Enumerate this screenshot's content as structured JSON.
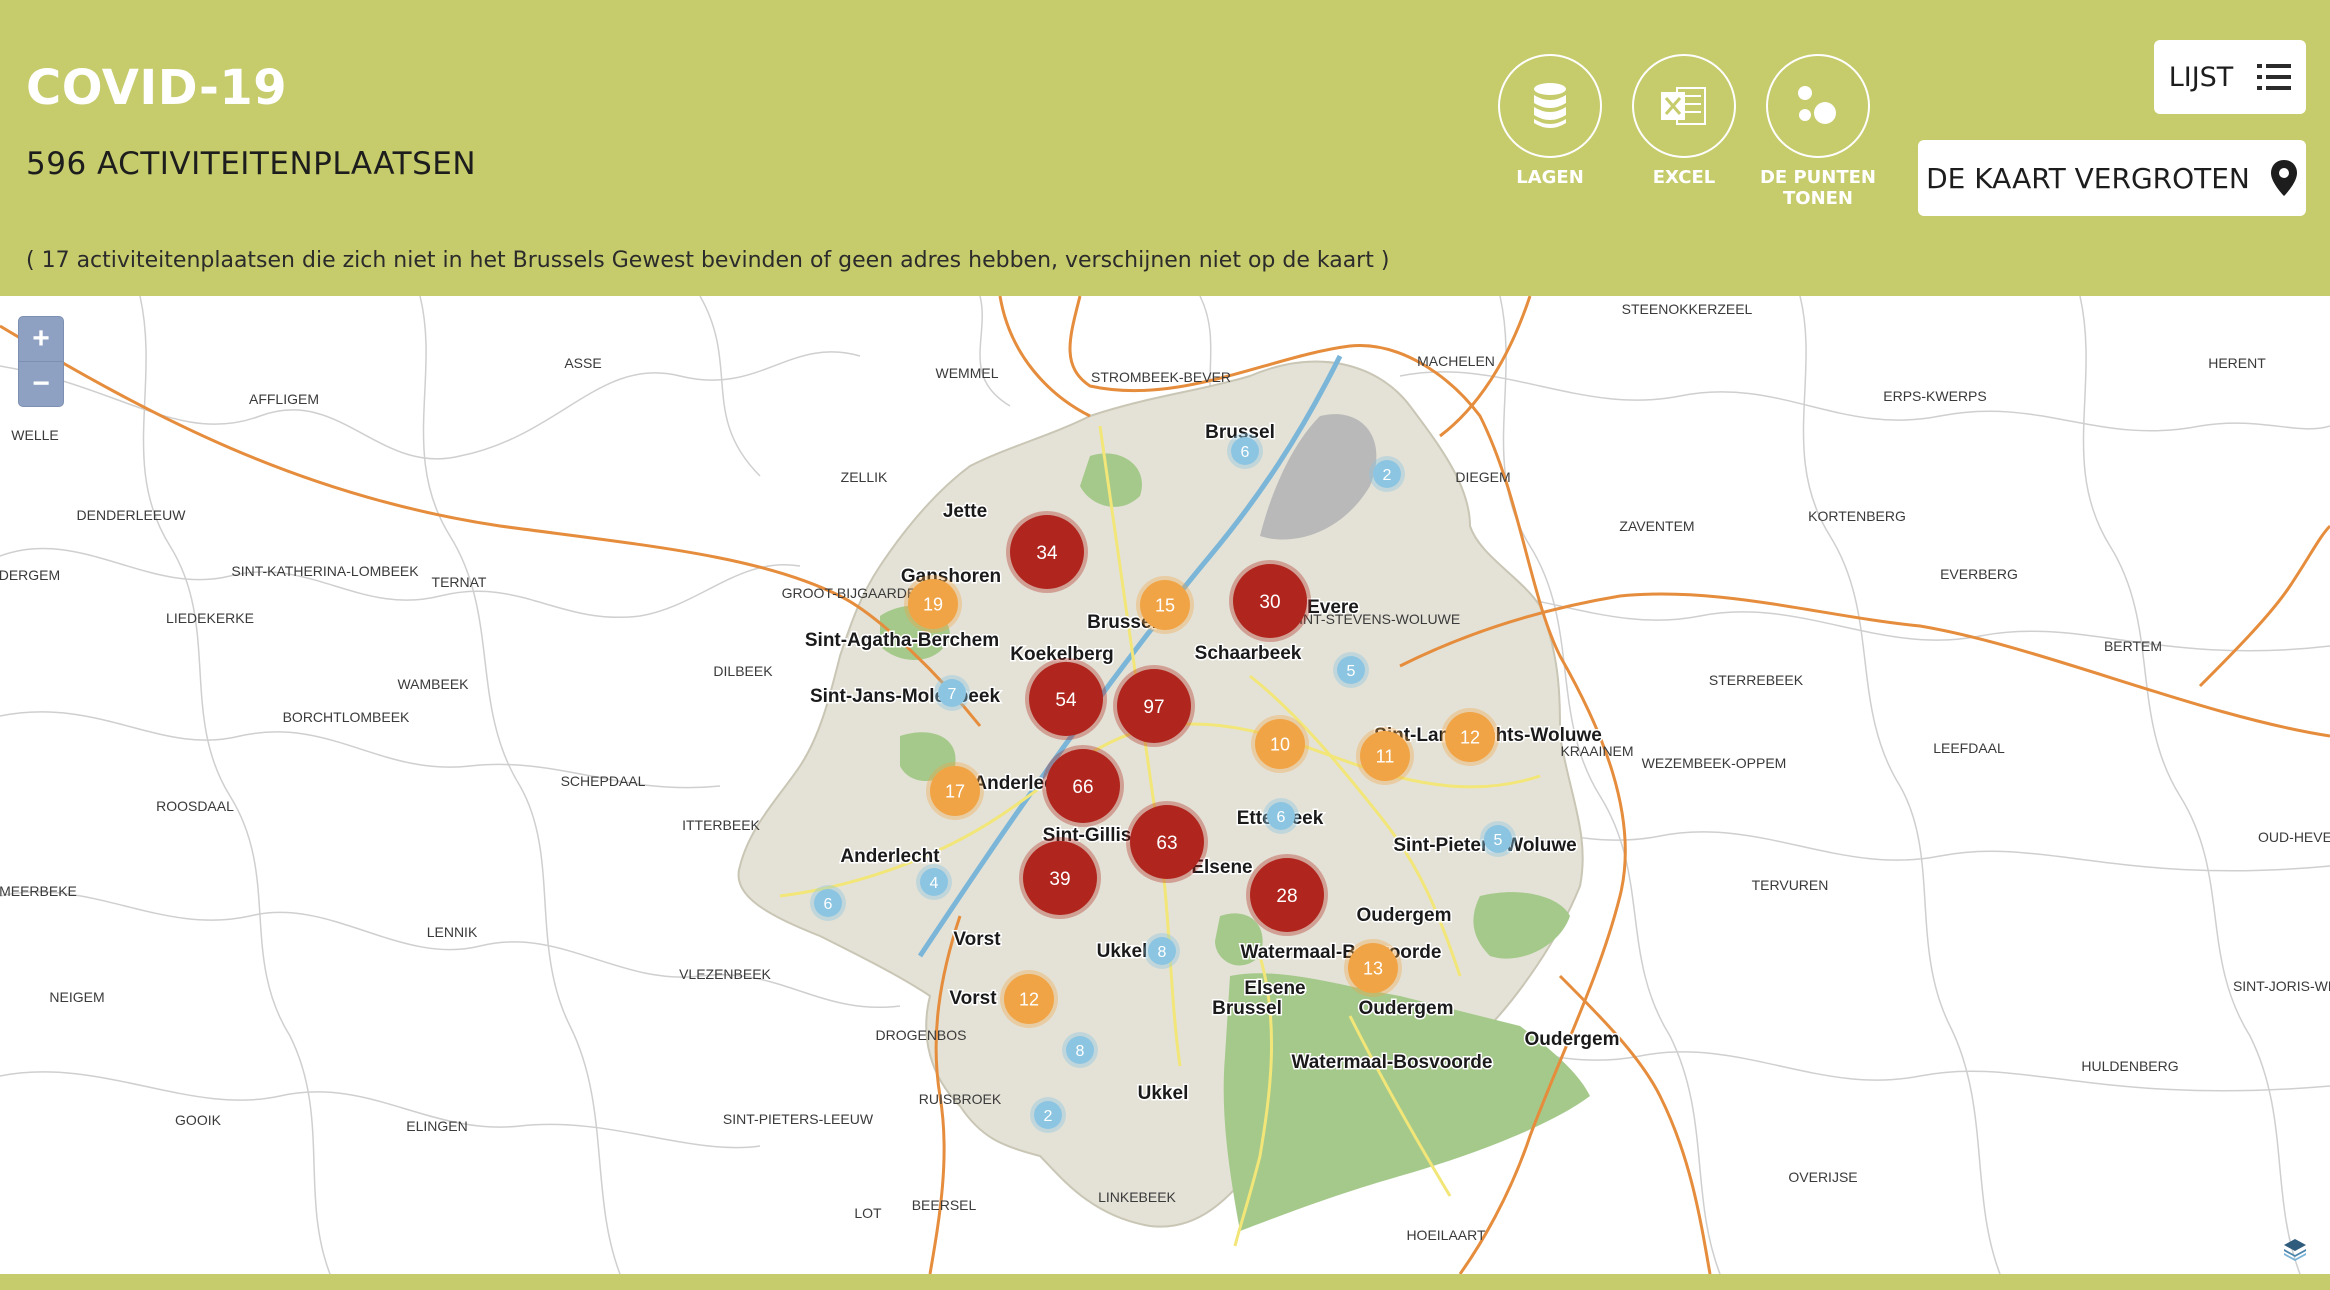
{
  "header": {
    "title": "COVID-19",
    "subtitle": "596 ACTIVITEITENPLAATSEN",
    "note": "( 17 activiteitenplaatsen die zich niet in het Brussels Gewest bevinden of geen adres hebben, verschijnen niet op de kaart )"
  },
  "tools": [
    {
      "label": "LAGEN",
      "icon": "database-icon"
    },
    {
      "label": "EXCEL",
      "icon": "excel-icon"
    },
    {
      "label": "DE PUNTEN TONEN",
      "icon": "points-icon"
    }
  ],
  "buttons": {
    "list_label": "LIJST",
    "enlarge_label": "DE KAART VERGROTEN"
  },
  "zoom": {
    "in": "+",
    "out": "−"
  },
  "colors": {
    "header_bg": "#c6cb6c",
    "cluster_large": "#b0261e",
    "cluster_medium": "#f0a445",
    "cluster_small": "#8cc5e2",
    "park": "#a5c98b",
    "urban": "#e4e2d6"
  },
  "map": {
    "outer_labels": [
      "STEENOKKERZEEL",
      "HERENT",
      "MACHELEN",
      "ASSE",
      "WEMMEL",
      "STROMBEEK-BEVER",
      "AFFLIGEM",
      "ERPS-KWERPS",
      "WELLE",
      "DIEGEM",
      "ZELLIK",
      "DENDERLEEUW",
      "ZAVENTEM",
      "KORTENBERG",
      "ODERGEM",
      "SINT-KATHERINA-LOMBEEK",
      "TERNAT",
      "GROOT-BIJGAARDEN",
      "EVERBERG",
      "SINT-STEVENS-WOLUWE",
      "LIEDEKERKE",
      "BERTEM",
      "DILBEEK",
      "STERREBEEK",
      "WAMBEEK",
      "BORCHTLOMBEEK",
      "KRAAINEM",
      "LEEFDAAL",
      "WEZEMBEEK-OPPEM",
      "SCHEPDAAL",
      "ROOSDAAL",
      "ITTERBEEK",
      "OUD-HEVE",
      "TERVUREN",
      "MEERBEKE",
      "LENNIK",
      "VLEZENBEEK",
      "SINT-JORIS-WEI",
      "NEIGEM",
      "DROGENBOS",
      "HULDENBERG",
      "RUISBROEK",
      "GOOIK",
      "ELINGEN",
      "SINT-PIETERS-LEEUW",
      "LINKEBEEK",
      "OVERIJSE",
      "LOT",
      "BEERSEL",
      "HOEILAART"
    ],
    "inner_labels": [
      "Brussel",
      "Jette",
      "Ganshoren",
      "Evere",
      "Brussel",
      "Sint-Agatha-Berchem",
      "Koekelberg",
      "Schaarbeek",
      "Sint-Jans-Molenbeek",
      "Sint-Lambrechts-Woluwe",
      "Anderlecht",
      "Etterbeek",
      "Sint-Gillis",
      "Sint-Pieters-Woluwe",
      "Anderlecht",
      "Elsene",
      "Vorst",
      "Oudergem",
      "Ukkel",
      "Watermaal-Bosvoorde",
      "Vorst",
      "Elsene",
      "Brussel",
      "Oudergem",
      "Oudergem",
      "Watermaal-Bosvoorde",
      "Ukkel"
    ],
    "clusters": [
      34,
      19,
      15,
      30,
      54,
      97,
      7,
      5,
      10,
      11,
      12,
      17,
      66,
      63,
      6,
      5,
      39,
      28,
      6,
      4,
      8,
      13,
      12,
      8,
      2,
      6,
      2
    ]
  }
}
